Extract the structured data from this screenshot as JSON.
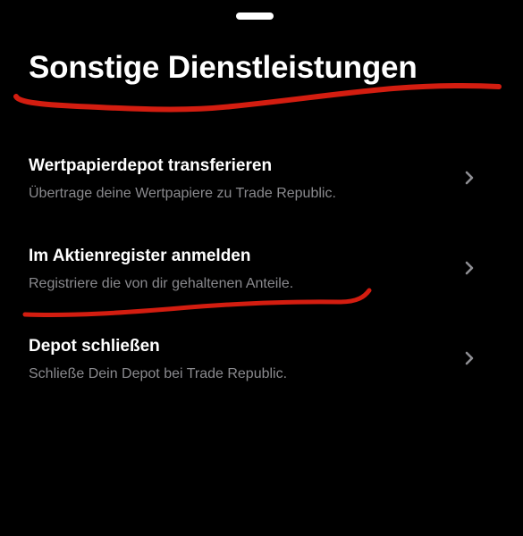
{
  "sheet": {
    "title": "Sonstige Dienstleistungen"
  },
  "items": [
    {
      "title": "Wertpapierdepot transferieren",
      "subtitle": "Übertrage deine Wertpapiere zu Trade Republic."
    },
    {
      "title": "Im Aktienregister anmelden",
      "subtitle": "Registriere die von dir gehaltenen Anteile."
    },
    {
      "title": "Depot schließen",
      "subtitle": "Schließe Dein Depot bei Trade Republic."
    }
  ],
  "icons": {
    "chevron": "chevron-right-icon"
  },
  "colors": {
    "background": "#000000",
    "title_text": "#ffffff",
    "subtitle_text": "#8a8a8e",
    "chevron": "#8e8e93",
    "annotation": "#d31d10"
  }
}
